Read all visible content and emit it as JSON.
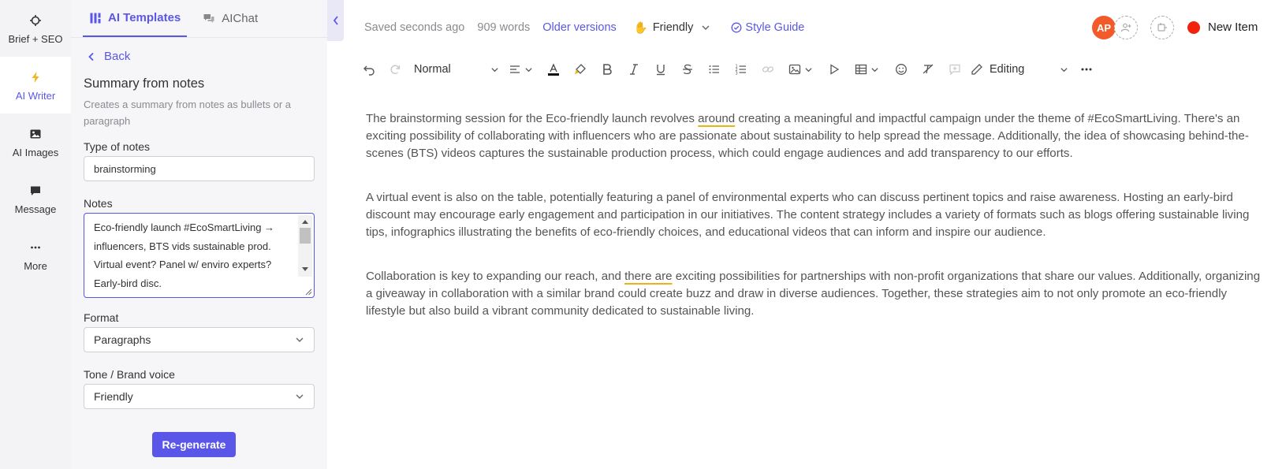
{
  "rail": {
    "items": [
      {
        "label": "Brief + SEO",
        "icon": "crosshair-icon"
      },
      {
        "label": "AI Writer",
        "icon": "lightning-icon"
      },
      {
        "label": "AI Images",
        "icon": "image-icon"
      },
      {
        "label": "Message",
        "icon": "chat-bubble-icon"
      },
      {
        "label": "More",
        "icon": "more-dots-icon"
      }
    ],
    "active_index": 1
  },
  "panel": {
    "tabs": [
      {
        "label": "AI Templates",
        "icon": "templates-icon"
      },
      {
        "label": "AIChat",
        "icon": "chat-icon"
      }
    ],
    "back_label": "Back",
    "title": "Summary from notes",
    "description": "Creates a summary from notes as bullets or a paragraph",
    "type_of_notes_label": "Type of notes",
    "type_of_notes_value": "brainstorming",
    "notes_label": "Notes",
    "notes_lines": [
      "Eco-friendly launch #EcoSmartLiving →",
      "influencers, BTS vids sustainable prod.",
      "Virtual event? Panel w/ enviro experts?",
      "Early-bird disc."
    ],
    "format_label": "Format",
    "format_value": "Paragraphs",
    "tone_label": "Tone / Brand voice",
    "tone_value": "Friendly",
    "regenerate_label": "Re-generate"
  },
  "topbar": {
    "saved": "Saved seconds ago",
    "words": "909 words",
    "older_versions": "Older versions",
    "tone": "Friendly",
    "style_guide": "Style Guide",
    "avatar_initials": "AP",
    "new_item": "New Item"
  },
  "toolbar": {
    "paragraph_style": "Normal",
    "mode": "Editing"
  },
  "document": {
    "p1": {
      "a": "The brainstorming session for the Eco-friendly launch revolves ",
      "u1": "around",
      "b": " creating a meaningful and impactful campaign under the theme of #EcoSmartLiving. There's an exciting possibility of collaborating with influencers who are passionate about sustainability to help spread the message. Additionally, the idea of showcasing behind-the-scenes (BTS) videos captures the sustainable production process, which could engage audiences and add transparency to our efforts."
    },
    "p2": "A virtual event is also on the table, potentially featuring a panel of environmental experts who can discuss pertinent topics and raise awareness. Hosting an early-bird discount may encourage early engagement and participation in our initiatives. The content strategy includes a variety of formats such as blogs offering sustainable living tips, infographics illustrating the benefits of eco-friendly choices, and educational videos that can inform and inspire our audience.",
    "p3": {
      "a": "Collaboration is key to expanding our reach, and ",
      "u1": "there are",
      "b": " exciting possibilities for partnerships with non-profit organizations that share our values. Additionally, organizing a giveaway in collaboration with a similar brand could create buzz and draw in diverse audiences. Together, these strategies aim to not only promote an eco-friendly lifestyle but also build a vibrant community dedicated to sustainable living."
    }
  },
  "colors": {
    "accent": "#5a57e8",
    "avatar": "#f25a2a",
    "new_item_dot": "#f1230a",
    "underline": "#e8b417"
  }
}
